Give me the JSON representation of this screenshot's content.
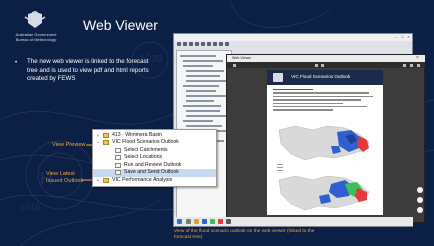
{
  "logo": {
    "line1": "Australian Government",
    "line2": "Bureau of Meteorology"
  },
  "title": "Web Viewer",
  "bullet": {
    "marker": "•",
    "text": "The new web viewer is linked to the forecast tree and is used to view pdf and html reports created by FEWS"
  },
  "callouts": {
    "view_preview": "View Preview",
    "view_latest": "View Latest Issued Outlook"
  },
  "forecast_tree": {
    "items": [
      {
        "toggle": "+",
        "label": "413 - Wimmera Basin",
        "type": "folder",
        "indent": 10,
        "selected": false
      },
      {
        "toggle": "−",
        "label": "VIC Flood Scenarios Outlook",
        "type": "folder",
        "indent": 10,
        "selected": false
      },
      {
        "toggle": "",
        "label": "Select Catchments",
        "type": "doc",
        "indent": 22,
        "selected": false
      },
      {
        "toggle": "",
        "label": "Select Locations",
        "type": "doc",
        "indent": 22,
        "selected": false
      },
      {
        "toggle": "",
        "label": "Run and Review Outlook",
        "type": "doc",
        "indent": 22,
        "selected": false
      },
      {
        "toggle": "",
        "label": "Save and Send Outlook",
        "type": "doc",
        "indent": 22,
        "selected": true
      },
      {
        "toggle": "+",
        "label": "VIC Performance Analysis",
        "type": "folder",
        "indent": 10,
        "selected": false
      }
    ]
  },
  "viewer": {
    "window_title": "Web Viewer",
    "close_glyph": "×",
    "page_title": "VIC Flood Scenarios Outlook"
  },
  "caption": "View of the flood scenario outlook on the web viewer (linked to the forecast tree)",
  "colors": {
    "background": "#0c1f45",
    "accent": "#f0a63a",
    "map_land": "#d9d9d9",
    "map_blue": "#2f5fd0",
    "map_red": "#e23a3a",
    "map_green": "#3fbf5a"
  },
  "icons": {
    "crest": "coat-of-arms-icon",
    "folder": "folder-icon",
    "document": "document-icon",
    "close": "close-icon",
    "arrow": "arrow-icon"
  }
}
